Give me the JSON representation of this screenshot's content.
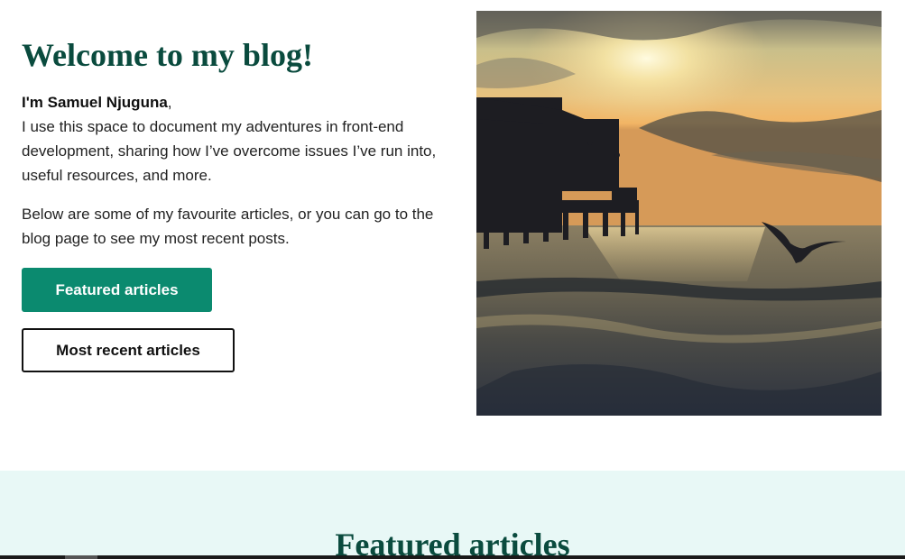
{
  "hero": {
    "title": "Welcome to my blog!",
    "name": "I'm Samuel Njuguna",
    "comma": ",",
    "bio": "I use this space to document my adventures in front-end development, sharing how I’ve overcome issues I’ve run into, useful resources, and more.",
    "paragraph": "Below are some of my favourite articles, or you can go to the blog page to see my most recent posts.",
    "primary_button": "Featured articles",
    "secondary_button": "Most recent articles",
    "image_alt": "Sunset over the sea beside a pier with a flying seagull"
  },
  "featured": {
    "title": "Featured articles"
  },
  "colors": {
    "heading": "#0a4b3e",
    "primary": "#0b8a6f",
    "section_bg": "#e8f8f6"
  }
}
